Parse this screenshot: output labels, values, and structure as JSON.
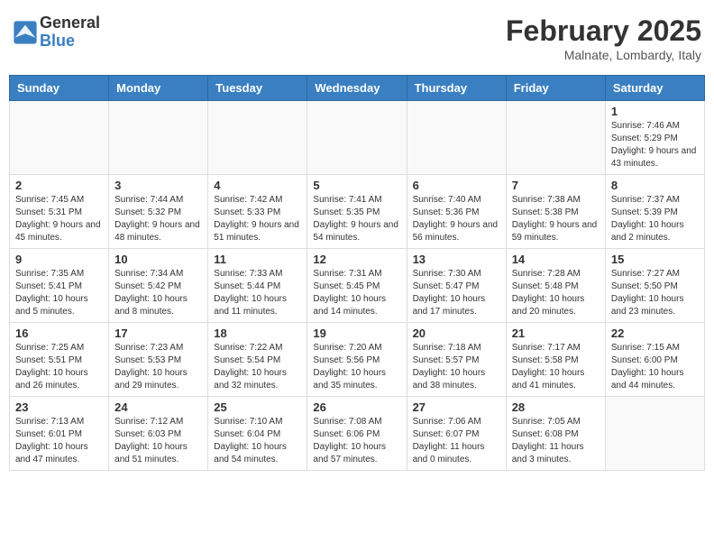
{
  "header": {
    "logo_general": "General",
    "logo_blue": "Blue",
    "month_title": "February 2025",
    "location": "Malnate, Lombardy, Italy"
  },
  "weekdays": [
    "Sunday",
    "Monday",
    "Tuesday",
    "Wednesday",
    "Thursday",
    "Friday",
    "Saturday"
  ],
  "weeks": [
    [
      {
        "day": "",
        "info": ""
      },
      {
        "day": "",
        "info": ""
      },
      {
        "day": "",
        "info": ""
      },
      {
        "day": "",
        "info": ""
      },
      {
        "day": "",
        "info": ""
      },
      {
        "day": "",
        "info": ""
      },
      {
        "day": "1",
        "info": "Sunrise: 7:46 AM\nSunset: 5:29 PM\nDaylight: 9 hours and 43 minutes."
      }
    ],
    [
      {
        "day": "2",
        "info": "Sunrise: 7:45 AM\nSunset: 5:31 PM\nDaylight: 9 hours and 45 minutes."
      },
      {
        "day": "3",
        "info": "Sunrise: 7:44 AM\nSunset: 5:32 PM\nDaylight: 9 hours and 48 minutes."
      },
      {
        "day": "4",
        "info": "Sunrise: 7:42 AM\nSunset: 5:33 PM\nDaylight: 9 hours and 51 minutes."
      },
      {
        "day": "5",
        "info": "Sunrise: 7:41 AM\nSunset: 5:35 PM\nDaylight: 9 hours and 54 minutes."
      },
      {
        "day": "6",
        "info": "Sunrise: 7:40 AM\nSunset: 5:36 PM\nDaylight: 9 hours and 56 minutes."
      },
      {
        "day": "7",
        "info": "Sunrise: 7:38 AM\nSunset: 5:38 PM\nDaylight: 9 hours and 59 minutes."
      },
      {
        "day": "8",
        "info": "Sunrise: 7:37 AM\nSunset: 5:39 PM\nDaylight: 10 hours and 2 minutes."
      }
    ],
    [
      {
        "day": "9",
        "info": "Sunrise: 7:35 AM\nSunset: 5:41 PM\nDaylight: 10 hours and 5 minutes."
      },
      {
        "day": "10",
        "info": "Sunrise: 7:34 AM\nSunset: 5:42 PM\nDaylight: 10 hours and 8 minutes."
      },
      {
        "day": "11",
        "info": "Sunrise: 7:33 AM\nSunset: 5:44 PM\nDaylight: 10 hours and 11 minutes."
      },
      {
        "day": "12",
        "info": "Sunrise: 7:31 AM\nSunset: 5:45 PM\nDaylight: 10 hours and 14 minutes."
      },
      {
        "day": "13",
        "info": "Sunrise: 7:30 AM\nSunset: 5:47 PM\nDaylight: 10 hours and 17 minutes."
      },
      {
        "day": "14",
        "info": "Sunrise: 7:28 AM\nSunset: 5:48 PM\nDaylight: 10 hours and 20 minutes."
      },
      {
        "day": "15",
        "info": "Sunrise: 7:27 AM\nSunset: 5:50 PM\nDaylight: 10 hours and 23 minutes."
      }
    ],
    [
      {
        "day": "16",
        "info": "Sunrise: 7:25 AM\nSunset: 5:51 PM\nDaylight: 10 hours and 26 minutes."
      },
      {
        "day": "17",
        "info": "Sunrise: 7:23 AM\nSunset: 5:53 PM\nDaylight: 10 hours and 29 minutes."
      },
      {
        "day": "18",
        "info": "Sunrise: 7:22 AM\nSunset: 5:54 PM\nDaylight: 10 hours and 32 minutes."
      },
      {
        "day": "19",
        "info": "Sunrise: 7:20 AM\nSunset: 5:56 PM\nDaylight: 10 hours and 35 minutes."
      },
      {
        "day": "20",
        "info": "Sunrise: 7:18 AM\nSunset: 5:57 PM\nDaylight: 10 hours and 38 minutes."
      },
      {
        "day": "21",
        "info": "Sunrise: 7:17 AM\nSunset: 5:58 PM\nDaylight: 10 hours and 41 minutes."
      },
      {
        "day": "22",
        "info": "Sunrise: 7:15 AM\nSunset: 6:00 PM\nDaylight: 10 hours and 44 minutes."
      }
    ],
    [
      {
        "day": "23",
        "info": "Sunrise: 7:13 AM\nSunset: 6:01 PM\nDaylight: 10 hours and 47 minutes."
      },
      {
        "day": "24",
        "info": "Sunrise: 7:12 AM\nSunset: 6:03 PM\nDaylight: 10 hours and 51 minutes."
      },
      {
        "day": "25",
        "info": "Sunrise: 7:10 AM\nSunset: 6:04 PM\nDaylight: 10 hours and 54 minutes."
      },
      {
        "day": "26",
        "info": "Sunrise: 7:08 AM\nSunset: 6:06 PM\nDaylight: 10 hours and 57 minutes."
      },
      {
        "day": "27",
        "info": "Sunrise: 7:06 AM\nSunset: 6:07 PM\nDaylight: 11 hours and 0 minutes."
      },
      {
        "day": "28",
        "info": "Sunrise: 7:05 AM\nSunset: 6:08 PM\nDaylight: 11 hours and 3 minutes."
      },
      {
        "day": "",
        "info": ""
      }
    ]
  ]
}
